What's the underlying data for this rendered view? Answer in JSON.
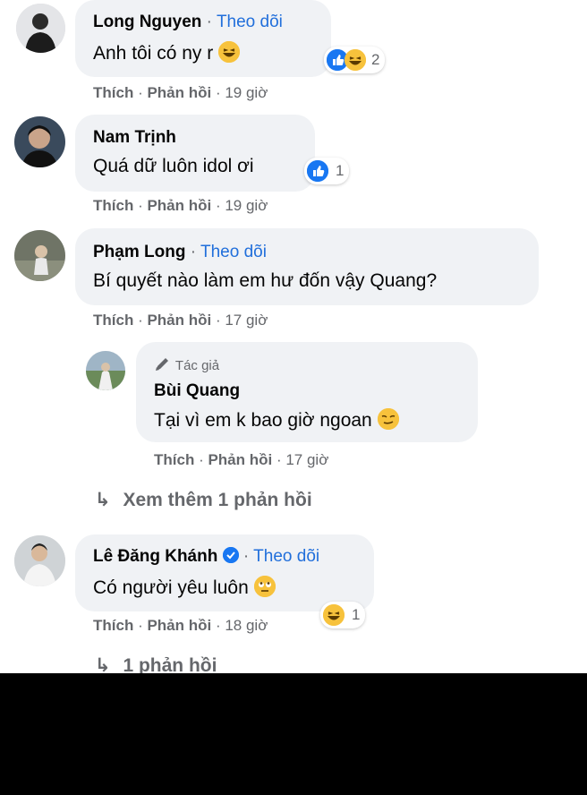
{
  "comments": [
    {
      "name": "Long Nguyen",
      "follow": "Theo dõi",
      "text": "Anh tôi có ny r",
      "like": "Thích",
      "reply": "Phản hồi",
      "time": "19 giờ",
      "reaction_count": "2"
    },
    {
      "name": "Nam Trịnh",
      "text": "Quá dữ luôn idol ơi",
      "like": "Thích",
      "reply": "Phản hồi",
      "time": "19 giờ",
      "reaction_count": "1"
    },
    {
      "name": "Phạm Long",
      "follow": "Theo dõi",
      "text": "Bí quyết nào làm em hư đốn vậy Quang?",
      "like": "Thích",
      "reply": "Phản hồi",
      "time": "17 giờ"
    },
    {
      "name": "Lê Đăng Khánh",
      "follow": "Theo dõi",
      "text": "Có người yêu luôn",
      "like": "Thích",
      "reply": "Phản hồi",
      "time": "18 giờ",
      "reaction_count": "1"
    }
  ],
  "reply": {
    "author_tag": "Tác giả",
    "name": "Bùi Quang",
    "text": "Tại vì em k bao giờ ngoan",
    "like": "Thích",
    "reply": "Phản hồi",
    "time": "17 giờ"
  },
  "more_replies": "Xem thêm 1 phản hồi",
  "more_replies_2": "1 phản hồi",
  "separator": " · ",
  "arrow": "↳",
  "colors": {
    "bubble": "#f0f2f5",
    "link": "#216fdb",
    "meta": "#65676b",
    "like": "#1877f2",
    "haha": "#f7c23c"
  }
}
